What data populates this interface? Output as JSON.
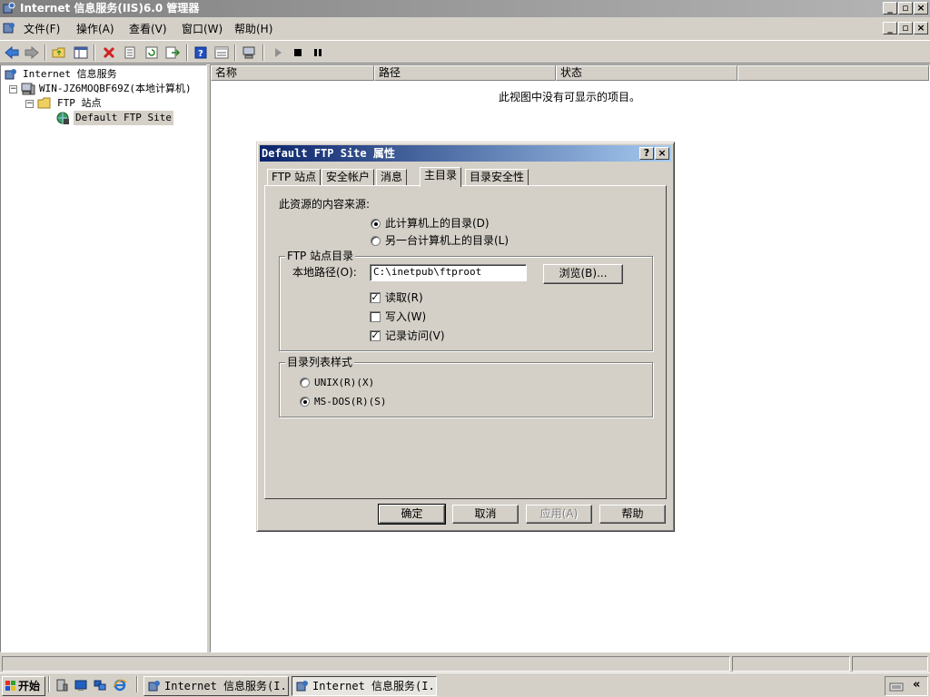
{
  "window": {
    "title": "Internet 信息服务(IIS)6.0 管理器",
    "controls": [
      "_",
      "□",
      "×"
    ]
  },
  "menu": {
    "items": [
      "文件(F)",
      "操作(A)",
      "查看(V)",
      "窗口(W)",
      "帮助(H)"
    ]
  },
  "tree": {
    "root": "Internet 信息服务",
    "computer": "WIN-JZ6MOQBF69Z(本地计算机)",
    "ftp_sites": "FTP 站点",
    "default_site": "Default FTP Site"
  },
  "list": {
    "columns": [
      "名称",
      "路径",
      "状态"
    ],
    "empty_message": "此视图中没有可显示的项目。"
  },
  "dialog": {
    "title": "Default FTP Site 属性",
    "help_glyph": "?",
    "close_glyph": "×",
    "tabs": [
      "FTP 站点",
      "安全帐户",
      "消息",
      "主目录",
      "目录安全性"
    ],
    "selected_tab": "主目录",
    "content_source_label": "此资源的内容来源:",
    "source_options": [
      "此计算机上的目录(D)",
      "另一台计算机上的目录(L)"
    ],
    "ftp_dir_group": "FTP 站点目录",
    "local_path_label": "本地路径(O):",
    "local_path_value": "C:\\inetpub\\ftproot",
    "browse_button": "浏览(B)...",
    "checkboxes": [
      {
        "label": "读取(R)",
        "checked": true
      },
      {
        "label": "写入(W)",
        "checked": false
      },
      {
        "label": "记录访问(V)",
        "checked": true
      }
    ],
    "listing_group": "目录列表样式",
    "listing_options": [
      "UNIX(R)(X)",
      "MS-DOS(R)(S)"
    ],
    "buttons": {
      "ok": "确定",
      "cancel": "取消",
      "apply": "应用(A)",
      "help": "帮助"
    }
  },
  "taskbar": {
    "start": "开始",
    "tasks": [
      "Internet 信息服务(I...",
      "Internet 信息服务(I..."
    ],
    "collapse_glyph": "«"
  }
}
